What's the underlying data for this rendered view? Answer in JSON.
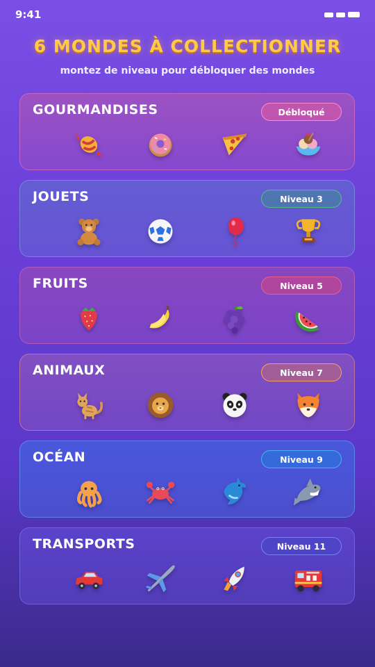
{
  "status_bar": {
    "time": "9:41"
  },
  "header": {
    "title": "6 MONDES À COLLECTIONNER",
    "subtitle": "montez de niveau pour débloquer des mondes"
  },
  "worlds": [
    {
      "title": "GOURMANDISES",
      "badge": "Débloqué",
      "theme": "pink",
      "icons": [
        "candy-icon",
        "donut-icon",
        "pizza-slice-icon",
        "ice-cream-bowl-icon"
      ]
    },
    {
      "title": "JOUETS",
      "badge": "Niveau 3",
      "theme": "teal",
      "icons": [
        "teddy-bear-icon",
        "soccer-ball-icon",
        "balloon-icon",
        "trophy-icon"
      ]
    },
    {
      "title": "FRUITS",
      "badge": "Niveau 5",
      "theme": "rose",
      "icons": [
        "strawberry-icon",
        "banana-icon",
        "grapes-icon",
        "watermelon-icon"
      ]
    },
    {
      "title": "ANIMAUX",
      "badge": "Niveau 7",
      "theme": "orange",
      "icons": [
        "cat-icon",
        "lion-icon",
        "panda-icon",
        "fox-icon"
      ]
    },
    {
      "title": "OCÉAN",
      "badge": "Niveau 9",
      "theme": "blue",
      "icons": [
        "octopus-icon",
        "crab-icon",
        "dolphin-icon",
        "shark-icon"
      ]
    },
    {
      "title": "TRANSPORTS",
      "badge": "Niveau 11",
      "theme": "indigo",
      "icons": [
        "car-icon",
        "airplane-icon",
        "rocket-icon",
        "fire-truck-icon"
      ]
    }
  ],
  "colors": {
    "title_gold": "#ffc94a",
    "pink_card": "#b65ab8",
    "teal_card": "#5a6fc8",
    "rose_card": "#a65ab7",
    "orange_card": "#a56ab6",
    "blue_card": "#3e6be0",
    "indigo_card": "#6a4bd6"
  }
}
